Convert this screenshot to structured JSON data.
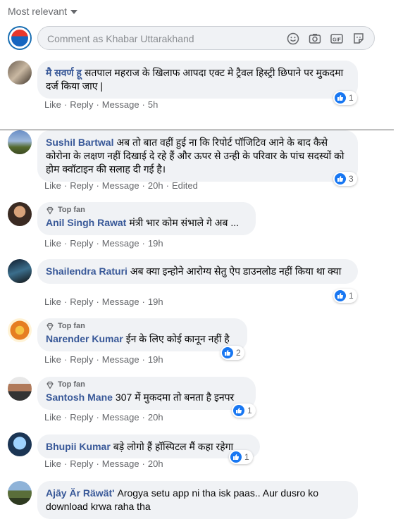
{
  "sort_label": "Most relevant",
  "composer": {
    "placeholder": "Comment as Khabar Uttarakhand"
  },
  "actions": {
    "like": "Like",
    "reply": "Reply",
    "message": "Message",
    "edited": "Edited"
  },
  "top_fan_label": "Top fan",
  "comments": [
    {
      "name": "मै सवर्ण हू",
      "text": "सतपाल महराज के खिलाफ आपदा एक्ट मे ट्रैवल हिस्ट्री छिपाने पर मुकदमा दर्ज किया जाए |",
      "time": "5h",
      "likes": "1",
      "top_fan": false
    },
    {
      "name": "Sushil Bartwal",
      "text": "अब तो बात वहीं हुई ना कि रिपोर्ट पॉजिटिव आने के बाद कैसे कोरोना के लक्षण नहीं दिखाई दे रहे हैं और ऊपर से उन्ही के परिवार के पांच सदस्यों को होम क्वॉटाइन की सलाह दी गई है।",
      "time": "20h",
      "likes": "3",
      "top_fan": false,
      "edited": true
    },
    {
      "name": "Anil Singh Rawat",
      "text": "मंत्री भार कोम संभाले गे अब ...",
      "time": "19h",
      "likes": "",
      "top_fan": true
    },
    {
      "name": "Shailendra Raturi",
      "text": "अब क्या इन्होने आरोग्य सेतु ऐप डाउनलोड नहीं किया था क्या",
      "time": "19h",
      "likes": "1",
      "top_fan": false
    },
    {
      "name": "Narender Kumar",
      "text": "ईन के लिए कोई कानून नहीं है",
      "time": "19h",
      "likes": "2",
      "top_fan": true
    },
    {
      "name": "Santosh Mane",
      "text": "307 में मुकदमा तो बनता है इनपर",
      "time": "20h",
      "likes": "1",
      "top_fan": true
    },
    {
      "name": "Bhupii Kumar",
      "text": "बड़े लोगो हैं हॉस्पिटल मैं कहा रहेगा",
      "time": "20h",
      "likes": "1",
      "top_fan": false
    },
    {
      "name": "Ajāy Är Räwät'",
      "text": "Arogya setu app ni tha isk paas.. Aur dusro ko download krwa raha tha",
      "time": "",
      "likes": "",
      "top_fan": false
    }
  ],
  "colors": {
    "name": "#385898",
    "like": "#1877f2",
    "bubble": "#f0f2f5"
  }
}
